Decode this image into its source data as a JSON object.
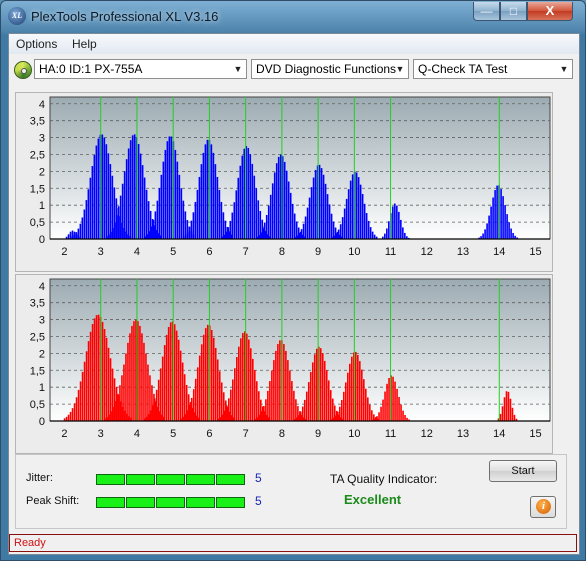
{
  "window": {
    "title": "PlexTools Professional XL V3.16",
    "icon_text": "XL"
  },
  "window_buttons": {
    "minimize_icon": "minimize-icon",
    "maximize_icon": "maximize-icon",
    "close_icon": "close-icon",
    "minimize_glyph": "—",
    "maximize_glyph": "□",
    "close_glyph": "X"
  },
  "menu": {
    "items": [
      "Options",
      "Help"
    ]
  },
  "toolbar": {
    "drive": "HA:0 ID:1  PX-755A",
    "function": "DVD Diagnostic Functions",
    "test": "Q-Check TA Test",
    "arrow_glyph": "▼"
  },
  "colors": {
    "jitter_bars": "#0000ff",
    "shift_bars": "#ff0000",
    "reference_lines": "#20d020",
    "meter_on": "#18f018",
    "quality_text": "#1b8a1b",
    "status_text": "#d01010"
  },
  "chart_data": [
    {
      "type": "bar",
      "name": "top-chart",
      "bar_color": "#0000ff",
      "x_ticks": [
        "2",
        "3",
        "4",
        "5",
        "6",
        "7",
        "8",
        "9",
        "10",
        "11",
        "12",
        "13",
        "14",
        "15"
      ],
      "y_ticks": [
        "4",
        "3,5",
        "3",
        "2,5",
        "2",
        "1,5",
        "1",
        "0,5",
        "0"
      ],
      "xlim": [
        1.6,
        15.4
      ],
      "ylim": [
        0,
        4.2
      ],
      "reference_lines_x": [
        3,
        4,
        5,
        6,
        7,
        8,
        9,
        10,
        11,
        14
      ],
      "peaks": [
        {
          "x": 2.2,
          "h": 0.25,
          "w": 0.12
        },
        {
          "x": 3.0,
          "h": 3.1,
          "w": 0.35
        },
        {
          "x": 3.9,
          "h": 3.1,
          "w": 0.33
        },
        {
          "x": 4.9,
          "h": 3.05,
          "w": 0.3
        },
        {
          "x": 5.95,
          "h": 2.95,
          "w": 0.3
        },
        {
          "x": 7.0,
          "h": 2.75,
          "w": 0.29
        },
        {
          "x": 7.95,
          "h": 2.5,
          "w": 0.29
        },
        {
          "x": 9.0,
          "h": 2.2,
          "w": 0.28
        },
        {
          "x": 10.0,
          "h": 2.0,
          "w": 0.27
        },
        {
          "x": 11.1,
          "h": 1.05,
          "w": 0.17
        },
        {
          "x": 13.95,
          "h": 1.6,
          "w": 0.23
        }
      ]
    },
    {
      "type": "bar",
      "name": "bottom-chart",
      "bar_color": "#ff0000",
      "x_ticks": [
        "2",
        "3",
        "4",
        "5",
        "6",
        "7",
        "8",
        "9",
        "10",
        "11",
        "12",
        "13",
        "14",
        "15"
      ],
      "y_ticks": [
        "4",
        "3,5",
        "3",
        "2,5",
        "2",
        "1,5",
        "1",
        "0,5",
        "0"
      ],
      "xlim": [
        1.6,
        15.4
      ],
      "ylim": [
        0,
        4.2
      ],
      "reference_lines_x": [
        3,
        4,
        5,
        6,
        7,
        8,
        9,
        10,
        11,
        14
      ],
      "peaks": [
        {
          "x": 2.9,
          "h": 3.15,
          "w": 0.4
        },
        {
          "x": 3.95,
          "h": 3.0,
          "w": 0.36
        },
        {
          "x": 4.95,
          "h": 2.95,
          "w": 0.33
        },
        {
          "x": 5.95,
          "h": 2.85,
          "w": 0.32
        },
        {
          "x": 6.95,
          "h": 2.65,
          "w": 0.31
        },
        {
          "x": 7.95,
          "h": 2.4,
          "w": 0.3
        },
        {
          "x": 9.0,
          "h": 2.2,
          "w": 0.29
        },
        {
          "x": 10.0,
          "h": 2.05,
          "w": 0.28
        },
        {
          "x": 11.0,
          "h": 1.35,
          "w": 0.22
        },
        {
          "x": 14.2,
          "h": 0.9,
          "w": 0.13
        }
      ]
    }
  ],
  "results": {
    "jitter_label": "Jitter:",
    "jitter_value": "5",
    "jitter_segments": 5,
    "peak_shift_label": "Peak Shift:",
    "peak_shift_value": "5",
    "peak_shift_segments": 5,
    "ta_quality_label": "TA Quality Indicator:",
    "ta_quality_value": "Excellent",
    "start_button": "Start",
    "info_glyph": "i"
  },
  "status": {
    "text": "Ready"
  }
}
